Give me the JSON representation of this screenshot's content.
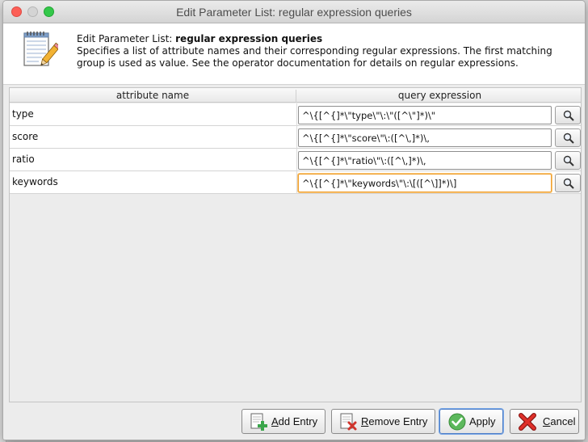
{
  "window": {
    "title": "Edit Parameter List: regular expression queries"
  },
  "header": {
    "title_prefix": "Edit Parameter List: ",
    "title_bold": "regular expression queries",
    "description": "Specifies a list of attribute names and their corresponding regular expressions. The first matching group is used as value. See the operator documentation for details on regular expressions."
  },
  "table": {
    "columns": [
      "attribute name",
      "query expression"
    ],
    "rows": [
      {
        "name": "type",
        "expression": "^\\{[^{]*\\\"type\\\"\\:\\\"([^\\\"]*)\\\""
      },
      {
        "name": "score",
        "expression": "^\\{[^{]*\\\"score\\\"\\:([^\\,]*)\\,"
      },
      {
        "name": "ratio",
        "expression": "^\\{[^{]*\\\"ratio\\\"\\:([^\\,]*)\\,"
      },
      {
        "name": "keywords",
        "expression": "^\\{[^{]*\\\"keywords\\\"\\:\\[([^\\]]*)\\]"
      }
    ]
  },
  "buttons": {
    "add": {
      "mnemonic": "A",
      "rest": "dd Entry"
    },
    "remove": {
      "mnemonic": "R",
      "rest": "emove Entry"
    },
    "apply": {
      "label": "Apply"
    },
    "cancel": {
      "mnemonic": "C",
      "rest": "ancel"
    }
  },
  "colors": {
    "focus_border": "#f0a030",
    "close": "#fc5f57",
    "maximize": "#34c84a"
  }
}
